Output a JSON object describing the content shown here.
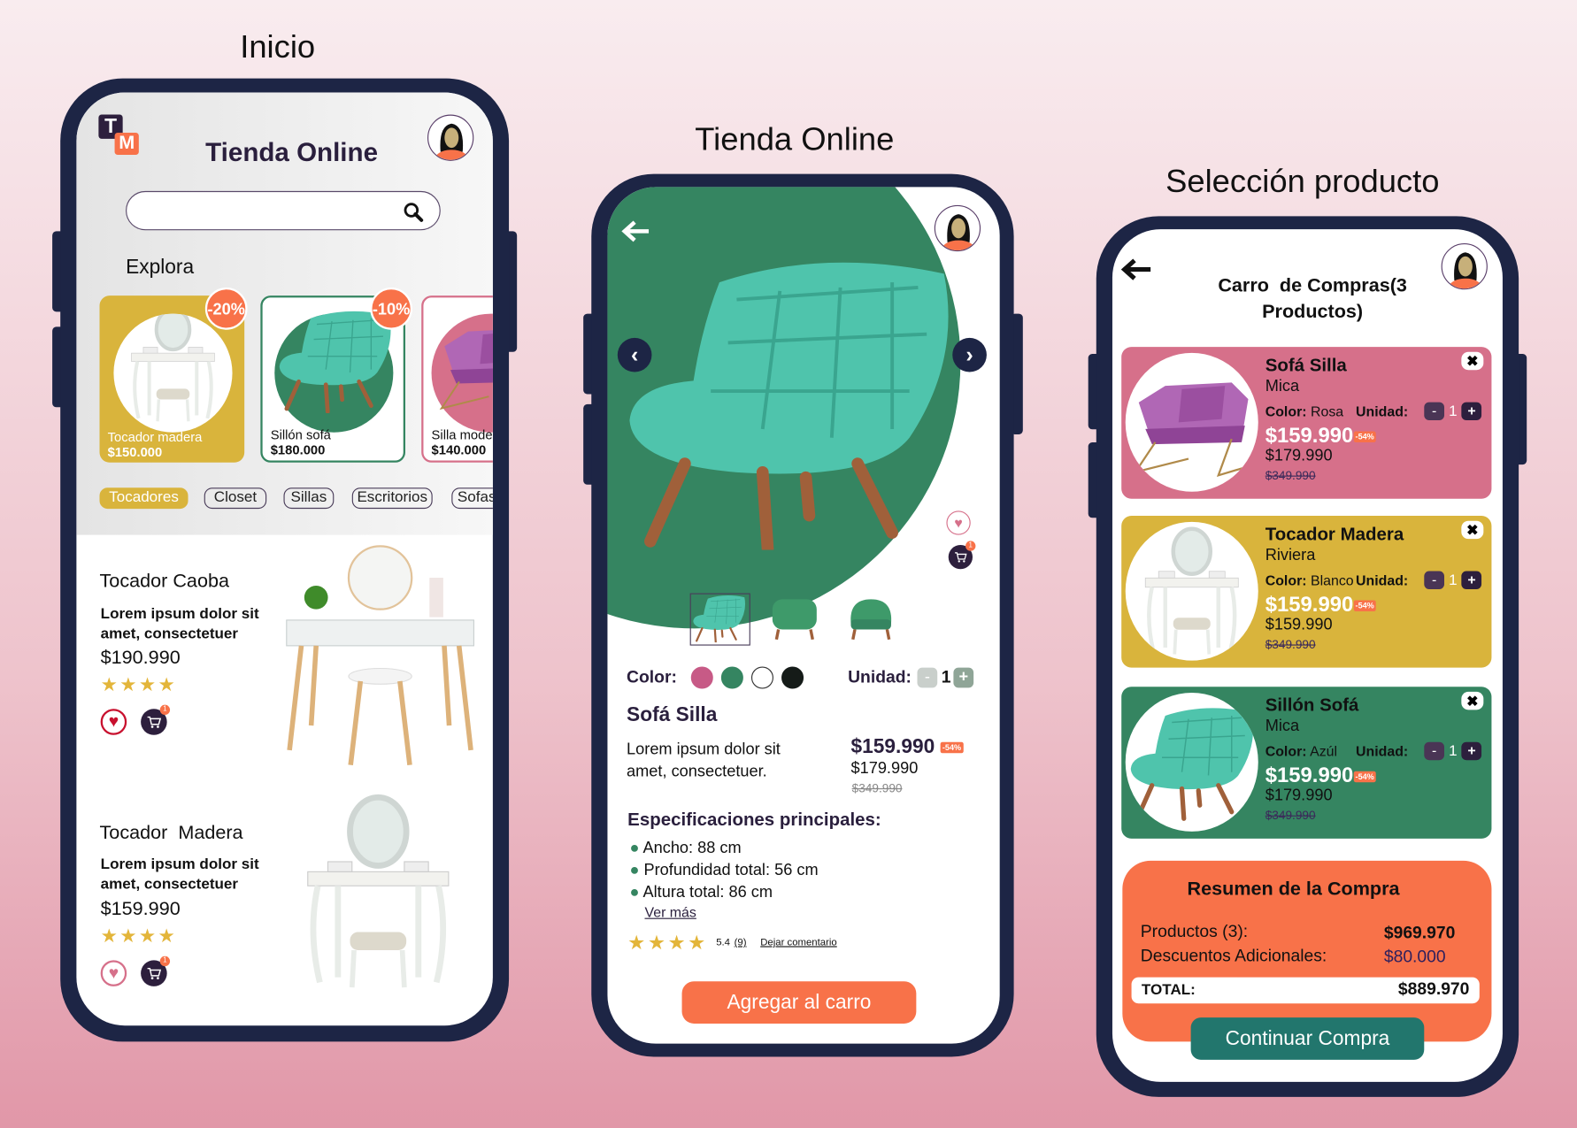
{
  "home": {
    "caption": "Inicio",
    "logo": "TM",
    "title": "Tienda Online",
    "search": {
      "placeholder": ""
    },
    "explore_label": "Explora",
    "featured": [
      {
        "name": "Tocador madera",
        "price": "$150.000",
        "discount": "-20%"
      },
      {
        "name": "Sillón sofá",
        "price": "$180.000",
        "discount": "-10%"
      },
      {
        "name": "Silla mode",
        "price": "$140.000"
      }
    ],
    "categories": [
      "Tocadores",
      "Closet",
      "Sillas",
      "Escritorios",
      "Sofas"
    ],
    "products": [
      {
        "name": "Tocador Caoba",
        "desc1": "Lorem ipsum dolor sit",
        "desc2": "amet, consectetuer",
        "price": "$190.990",
        "stars": "★★★★",
        "cart_count": "1"
      },
      {
        "name": "Tocador  Madera",
        "desc1": "Lorem ipsum dolor sit",
        "desc2": "amet, consectetuer",
        "price": "$159.990",
        "stars": "★★★★",
        "cart_count": "1"
      }
    ]
  },
  "product": {
    "caption": "Tienda Online",
    "color_label": "Color:",
    "colors": [
      "#c75a86",
      "#358561",
      "#ffffff",
      "#151b18"
    ],
    "unit_label": "Unidad:",
    "quantity": "1",
    "name": "Sofá Silla",
    "desc1": "Lorem ipsum dolor sit",
    "desc2": "amet, consectetuer.",
    "price": "$159.990",
    "discount": "-54%",
    "price2": "$179.990",
    "old_price": "$349.990",
    "specs_title": "Especificaciones principales:",
    "specs": [
      "Ancho: 88 cm",
      "Profundidad total: 56 cm",
      "Altura total: 86 cm"
    ],
    "see_more": "Ver más",
    "stars": "★★★★",
    "rating": "5.4",
    "reviews": "(9)",
    "comment_link": "Dejar comentario",
    "cart_count": "1",
    "add_button": "Agregar al carro"
  },
  "cart": {
    "caption": "Selección producto",
    "title1": "Carro  de Compras(3",
    "title2": "Productos)",
    "items": [
      {
        "name": "Sofá Silla",
        "sub": "Mica",
        "color_label": "Color:",
        "color": "Rosa",
        "unit_label": "Unidad:",
        "qty": "1",
        "price": "$159.990",
        "discount": "-54%",
        "price2": "$179.990",
        "old_price": "$349.990"
      },
      {
        "name": "Tocador Madera",
        "sub": "Riviera",
        "color_label": "Color:",
        "color": "Blanco",
        "unit_label": "Unidad:",
        "qty": "1",
        "price": "$159.990",
        "discount": "-54%",
        "price2": "$159.990",
        "old_price": "$349.990"
      },
      {
        "name": "Sillón Sofá",
        "sub": "Mica",
        "color_label": "Color:",
        "color": "Azúl",
        "unit_label": "Unidad:",
        "qty": "1",
        "price": "$159.990",
        "discount": "-54%",
        "price2": "$179.990",
        "old_price": "$349.990"
      }
    ],
    "summary": {
      "title": "Resumen de la Compra",
      "products_label": "Productos (3):",
      "products_value": "$969.970",
      "discount_label": "Descuentos Adicionales:",
      "discount_value": "$80.000",
      "total_label": "TOTAL:",
      "total_value": "$889.970",
      "continue_button": "Continuar Compra"
    }
  }
}
